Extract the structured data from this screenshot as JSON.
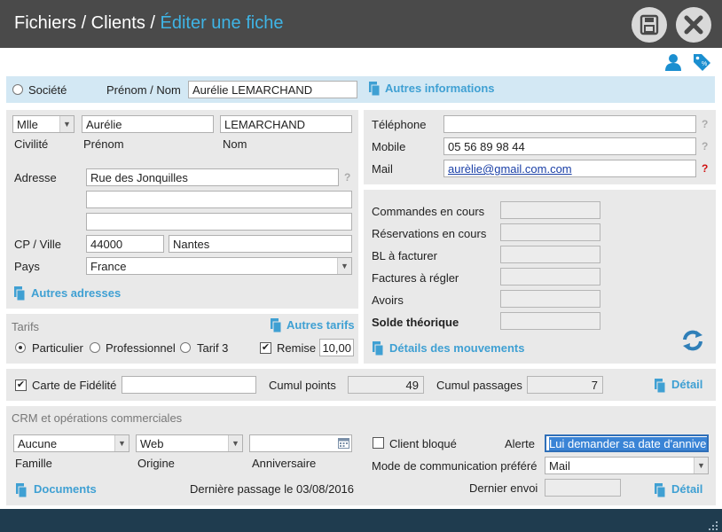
{
  "header": {
    "breadcrumb_1": "Fichiers / Clients / ",
    "breadcrumb_current": "Éditer une fiche"
  },
  "top": {
    "societe_label": "Société",
    "prenom_nom_label": "Prénom / Nom",
    "prenom_nom_value": "Aurélie LEMARCHAND",
    "autres_info_link": "Autres informations"
  },
  "identity": {
    "civilite_value": "Mlle",
    "prenom_value": "Aurélie",
    "nom_value": "LEMARCHAND",
    "civilite_label": "Civilité",
    "prenom_label": "Prénom",
    "nom_label": "Nom"
  },
  "address": {
    "adresse_label": "Adresse",
    "line1": "Rue des Jonquilles",
    "line2": "",
    "line3": "",
    "cp_ville_label": "CP / Ville",
    "cp": "44000",
    "ville": "Nantes",
    "pays_label": "Pays",
    "pays_value": "France",
    "autres_adresses_link": "Autres adresses"
  },
  "contact": {
    "telephone_label": "Téléphone",
    "telephone_value": "",
    "mobile_label": "Mobile",
    "mobile_value": "05 56 89 98 44",
    "mail_label": "Mail",
    "mail_value": "aurèlie@gmail.com.com",
    "q": "?"
  },
  "stats": {
    "commandes_label": "Commandes en cours",
    "reservations_label": "Réservations en cours",
    "bl_label": "BL à facturer",
    "factures_label": "Factures à régler",
    "avoirs_label": "Avoirs",
    "solde_label": "Solde théorique",
    "details_link": "Détails des mouvements"
  },
  "tarifs": {
    "title": "Tarifs",
    "autres_tarifs_link": "Autres tarifs",
    "particulier": "Particulier",
    "professionnel": "Professionnel",
    "tarif3": "Tarif 3",
    "remise_label": "Remise",
    "remise_value": "10,00"
  },
  "fidelite": {
    "carte_label": "Carte de Fidélité",
    "carte_value": "",
    "cumul_points_label": "Cumul points",
    "cumul_points_value": "49",
    "cumul_passages_label": "Cumul passages",
    "cumul_passages_value": "7",
    "detail_link": "Détail"
  },
  "crm": {
    "title": "CRM et opérations commerciales",
    "famille_value": "Aucune",
    "origine_value": "Web",
    "anniversaire_value": "",
    "famille_label": "Famille",
    "origine_label": "Origine",
    "anniversaire_label": "Anniversaire",
    "client_bloque_label": "Client bloqué",
    "alerte_label": "Alerte",
    "alerte_value": "Lui demander sa date d'anniversaire",
    "mode_label": "Mode de communication préféré",
    "mode_value": "Mail",
    "dernier_envoi_label": "Dernier envoi",
    "documents_link": "Documents",
    "derniere_passage": "Dernière passage le 03/08/2016",
    "detail_link": "Détail"
  },
  "colors": {
    "accent": "#3fa0d3",
    "titlebar": "#4a4a4a",
    "footer": "#1f3c4f"
  }
}
